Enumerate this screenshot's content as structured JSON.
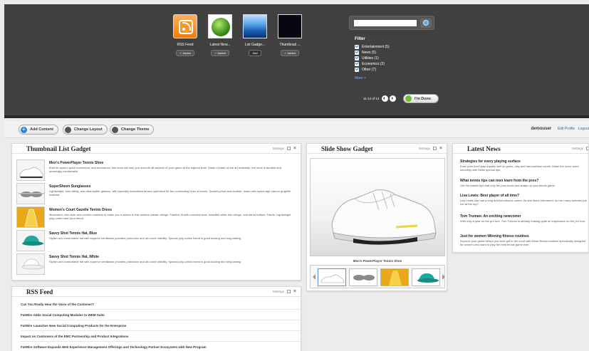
{
  "gallery": {
    "items": [
      {
        "name": "RSS Feed",
        "badge": "✓ Added",
        "icon": "rss-icon"
      },
      {
        "name": "Latest New...",
        "badge": "✓ Added",
        "icon": "news-globe-icon"
      },
      {
        "name": "List Gadge...",
        "badge": "Add",
        "icon": "list-gadget-icon"
      },
      {
        "name": "Thumbnail ...",
        "badge": "✓ Added",
        "icon": "thumbnail-gadget-icon"
      }
    ],
    "search_placeholder": "",
    "filter": {
      "title": "Filter",
      "options": [
        "Entertainment (5)",
        "News (5)",
        "Utilities (1)",
        "Economics (2)",
        "Other (7)"
      ],
      "more": "More >"
    },
    "pager": "11-14 of 14",
    "done_label": "I'm Done"
  },
  "toolbar": {
    "add_content": "Add Content",
    "change_layout": "Change Layout",
    "change_theme": "Change Theme",
    "username": "demouser",
    "edit_profile": "Edit Profile",
    "logout": "Logout"
  },
  "thumbnail_gadget": {
    "title": "Thumbnail List Gadget",
    "settings": "Settings",
    "items": [
      {
        "title": "Men's PowerPlayer Tennis Shoe",
        "desc": "Built for speed, quick movement, and endurance, this shoe will help you execute all aspects of your game at the highest level. Made of state-of-the art materials, the shoe is durable and amazingly comfortable."
      },
      {
        "title": "SuperSheen Sunglasses",
        "desc": "Lightweight, form-fitting, and ultra-stylish glasses, with specially formulated lenses optimized for the contrasting hues of tennis. Scratch-proof and durable, make with space-age carbon graphite material."
      },
      {
        "title": "Women's Court Gazelle Tennis Dress",
        "desc": "Movement, chic style and comfort combine to make you a winner in this modern classic design. Fashion fit with rounded-neck, beautiful white trim design, and flared bottom. Fabric: Lightweight poly-cotton and lycra blend."
      },
      {
        "title": "Savvy Shot Tennis Hat, Blue",
        "desc": "Stylish and comfortable hat with superior ventilation provides protection and all-round visibility. Special poly-cotton blend is good looking and long lasting."
      },
      {
        "title": "Savvy Shot Tennis Hat, White",
        "desc": "Stylish and comfortable hat with superior ventilation provides protection and all-round visibility. Special poly-cotton blend is good looking and long lasting."
      }
    ]
  },
  "slideshow": {
    "title": "Slide Show Gadget",
    "settings": "Settings",
    "caption": "Men's PowerPlayer Tennis Shoe"
  },
  "news": {
    "title": "Latest News",
    "settings": "Settings",
    "items": [
      {
        "title": "Strategies for every playing surface",
        "desc": "Even pros don't play equally well on grass, clay and hard-surface courts. Make the move more smoothly with these special tips."
      },
      {
        "title": "What tennis tips can men learn from the pros?",
        "desc": "Get the insider tips that only the pros know and shape up your tennis game."
      },
      {
        "title": "Lisa Lewis: Best player of all time?",
        "desc": "Lisa Lewis has had a long and tumultuous career. As she faces retirement, do her many victories put her at the top?"
      },
      {
        "title": "Tom Truman: An exciting newcomer",
        "desc": "With only a year on the pro tour, Tom Truman is already making quite an impression on the pro tour."
      },
      {
        "title": "Just for women Winning fitness routines",
        "desc": "Improve your game before you ever get to the court with these fitness routines specifically designed for women who want to play the best tennis game ever."
      }
    ]
  },
  "rss": {
    "title": "RSS Feed",
    "settings": "Settings",
    "items": [
      "Can You Really Hear the Voice of the Customer?",
      "FatWire Adds Social Computing Modules to WEM Suite",
      "FatWire Launches New Social Computing Products for the Enterprise",
      "Impact on Customers of the EMC Partnership and Product Integrations",
      "FatWire Software Expands Web Experience Management Offerings and Technology Partner Ecosystem with New Program"
    ]
  }
}
